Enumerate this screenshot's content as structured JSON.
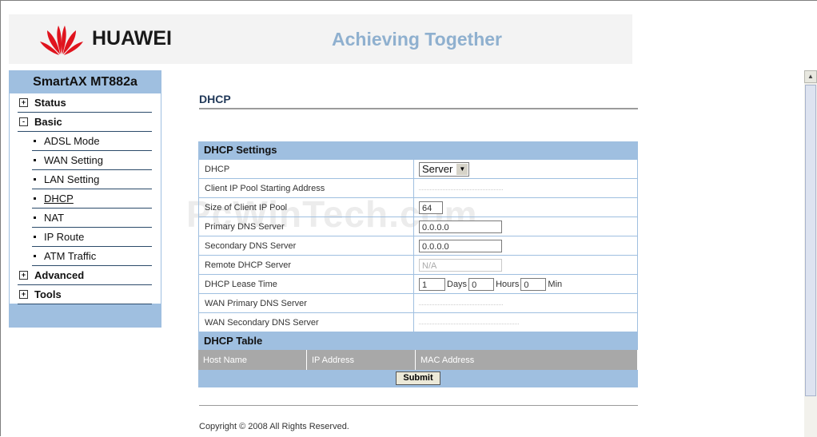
{
  "header": {
    "brand": "HUAWEI",
    "slogan": "Achieving Together"
  },
  "nav": {
    "model": "SmartAX MT882a",
    "items": [
      {
        "label": "Status",
        "kind": "group",
        "state": "+"
      },
      {
        "label": "Basic",
        "kind": "group",
        "state": "-"
      },
      {
        "label": "ADSL Mode",
        "kind": "sub"
      },
      {
        "label": "WAN Setting",
        "kind": "sub"
      },
      {
        "label": "LAN Setting",
        "kind": "sub"
      },
      {
        "label": "DHCP",
        "kind": "sub",
        "active": true
      },
      {
        "label": "NAT",
        "kind": "sub"
      },
      {
        "label": "IP Route",
        "kind": "sub"
      },
      {
        "label": "ATM Traffic",
        "kind": "sub"
      },
      {
        "label": "Advanced",
        "kind": "group",
        "state": "+"
      },
      {
        "label": "Tools",
        "kind": "group",
        "state": "+"
      }
    ]
  },
  "page": {
    "title": "DHCP"
  },
  "settings": {
    "header": "DHCP Settings",
    "rows": {
      "dhcp": {
        "label": "DHCP",
        "value": "Server"
      },
      "pool_start": {
        "label": "Client IP Pool Starting Address"
      },
      "pool_size": {
        "label": "Size of Client IP Pool",
        "value": "64"
      },
      "dns1": {
        "label": "Primary DNS Server",
        "value": "0.0.0.0"
      },
      "dns2": {
        "label": "Secondary DNS Server",
        "value": "0.0.0.0"
      },
      "remote": {
        "label": "Remote DHCP Server",
        "placeholder": "N/A"
      },
      "lease": {
        "label": "DHCP Lease Time",
        "days": "1",
        "days_label": "Days",
        "hours": "0",
        "hours_label": "Hours",
        "mins": "0",
        "mins_label": "Min"
      },
      "wan_dns1": {
        "label": "WAN Primary DNS Server"
      },
      "wan_dns2": {
        "label": "WAN Secondary DNS Server"
      }
    }
  },
  "dhcp_table": {
    "header": "DHCP Table",
    "columns": [
      "Host Name",
      "IP Address",
      "MAC Address"
    ]
  },
  "actions": {
    "submit": "Submit"
  },
  "footer": {
    "copyright": "Copyright © 2008 All Rights Reserved."
  },
  "watermark": "PcWinTech.com",
  "colors": {
    "accent": "#9fbfe0",
    "nav_border": "#2b4a6a",
    "table_header": "#a8a8a8",
    "brand_red": "#e0141e"
  }
}
